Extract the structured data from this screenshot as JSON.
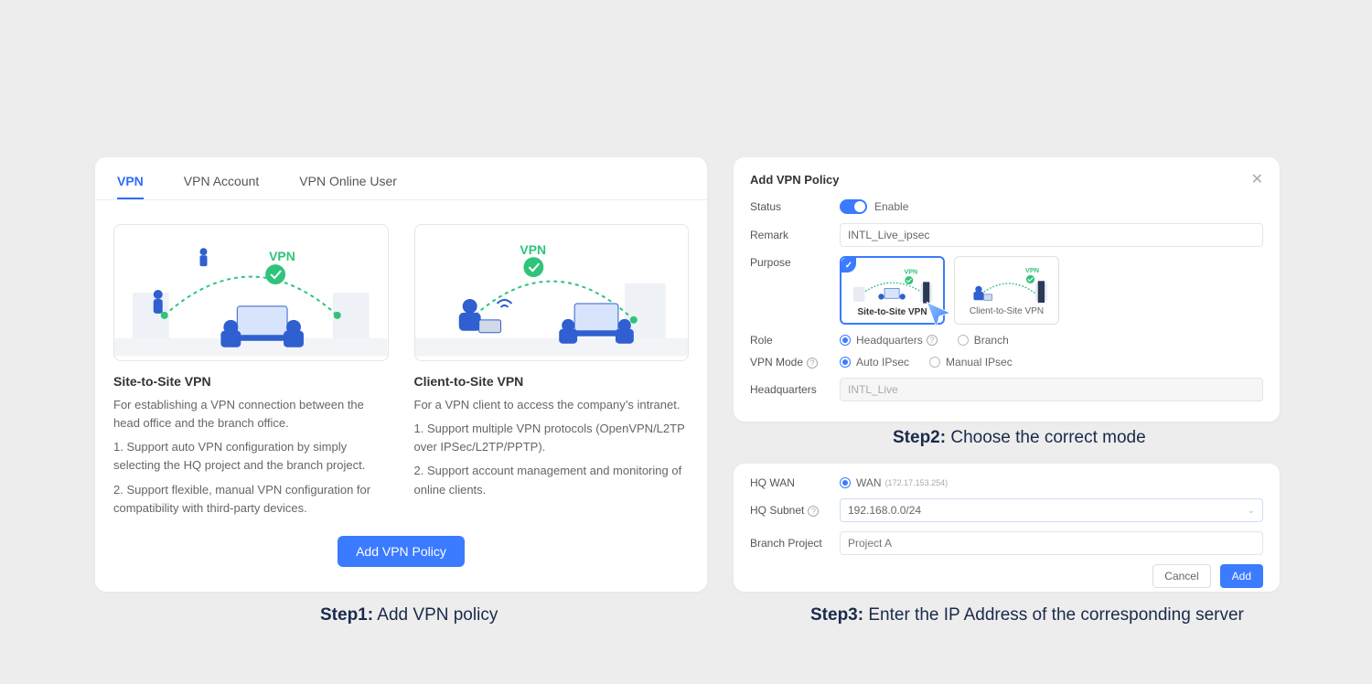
{
  "captions": {
    "step1_bold": "Step1:",
    "step1_rest": " Add VPN policy",
    "step2_bold": "Step2:",
    "step2_rest": " Choose the correct mode",
    "step3_bold": "Step3:",
    "step3_rest": " Enter the IP Address of the corresponding server"
  },
  "panel1": {
    "tabs": [
      "VPN",
      "VPN Account",
      "VPN Online User"
    ],
    "active_tab": 0,
    "site_card": {
      "title": "Site-to-Site VPN",
      "desc": "For establishing a VPN connection between the head office and the branch office.",
      "pt1": "1. Support auto VPN configuration by simply selecting the HQ project and the branch project.",
      "pt2": "2. Support flexible, manual VPN configuration for compatibility with third-party devices."
    },
    "client_card": {
      "title": "Client-to-Site VPN",
      "desc": "For a VPN client to access the company’s intranet.",
      "pt1": "1. Support multiple VPN protocols (OpenVPN/L2TP over IPSec/L2TP/PPTP).",
      "pt2": "2. Support account management and monitoring of online clients."
    },
    "add_btn": "Add VPN Policy",
    "badge": "VPN"
  },
  "panel2": {
    "title": "Add VPN Policy",
    "status_label": "Status",
    "enable": "Enable",
    "remark_label": "Remark",
    "remark_value": "INTL_Live_ipsec",
    "purpose_label": "Purpose",
    "purpose_opts": [
      "Site-to-Site VPN",
      "Client-to-Site VPN"
    ],
    "purpose_badge": "VPN",
    "role_label": "Role",
    "role_opts": [
      "Headquarters",
      "Branch"
    ],
    "mode_label": "VPN Mode",
    "mode_opts": [
      "Auto IPsec",
      "Manual IPsec"
    ],
    "hq_label": "Headquarters",
    "hq_value": "INTL_Live"
  },
  "panel3": {
    "hqwan_label": "HQ WAN",
    "wan_name": "WAN",
    "wan_ip": "(172.17.153.254)",
    "hqsubnet_label": "HQ Subnet",
    "hqsubnet_value": "192.168.0.0/24",
    "branch_label": "Branch Project",
    "branch_placeholder": "Project A",
    "cancel": "Cancel",
    "add": "Add"
  }
}
